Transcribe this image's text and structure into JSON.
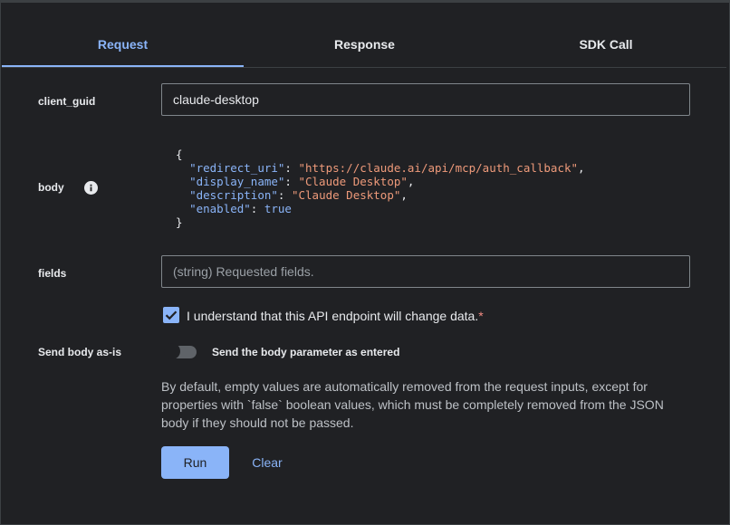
{
  "tabs": [
    {
      "label": "Request",
      "active": true
    },
    {
      "label": "Response",
      "active": false
    },
    {
      "label": "SDK Call",
      "active": false
    }
  ],
  "params": {
    "client_guid": {
      "label": "client_guid",
      "value": "claude-desktop"
    },
    "body": {
      "label": "body",
      "info_icon": "info-icon",
      "json": {
        "redirect_uri_key": "\"redirect_uri\"",
        "redirect_uri_value": "\"https://claude.ai/api/mcp/auth_callback\"",
        "display_name_key": "\"display_name\"",
        "display_name_value": "\"Claude Desktop\"",
        "description_key": "\"description\"",
        "description_value": "\"Claude Desktop\"",
        "enabled_key": "\"enabled\"",
        "enabled_value": "true"
      }
    },
    "fields": {
      "label": "fields",
      "placeholder": "(string) Requested fields."
    }
  },
  "confirm": {
    "checked": true,
    "label": "I understand that this API endpoint will change data.",
    "required_marker": "*"
  },
  "send_as_is": {
    "label": "Send body as-is",
    "toggle_on": false,
    "toggle_label": "Send the body parameter as entered"
  },
  "help_text": "By default, empty values are automatically removed from the request inputs, except for properties with `false` boolean values, which must be completely removed from the JSON body if they should not be passed.",
  "actions": {
    "run_label": "Run",
    "clear_label": "Clear"
  },
  "colors": {
    "background": "#202124",
    "accent": "#8ab4f8",
    "string": "#ee9a7a",
    "required": "#f28b82"
  }
}
